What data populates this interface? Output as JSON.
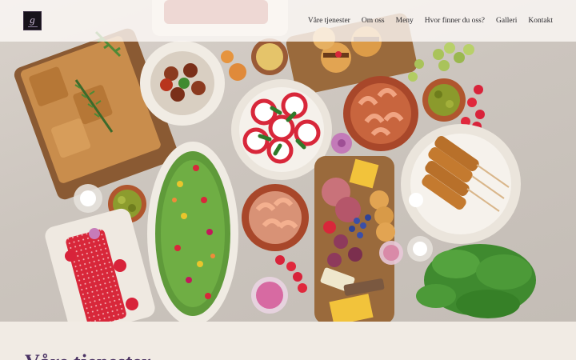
{
  "site": {
    "logo_letter": "g"
  },
  "nav": {
    "items": [
      {
        "label": "Våre tjenester"
      },
      {
        "label": "Om oss"
      },
      {
        "label": "Meny"
      },
      {
        "label": "Hvor finner du oss?"
      },
      {
        "label": "Galleri"
      },
      {
        "label": "Kontakt"
      }
    ]
  },
  "section": {
    "title": "Våre tjenester"
  },
  "colors": {
    "header_bg": "#fcf9f6",
    "nav_text": "#2b2a2e",
    "section_bg": "#f1ebe4",
    "section_title": "#4a3263",
    "logo_bg": "#16121a"
  }
}
